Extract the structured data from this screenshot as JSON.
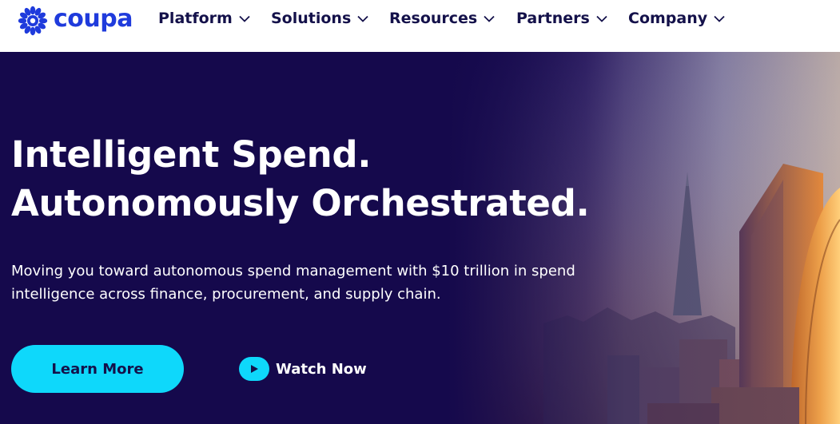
{
  "brand": {
    "name": "coupa",
    "color": "#1f3bdc",
    "icon": "coupa-starburst-icon"
  },
  "nav": {
    "items": [
      {
        "label": "Platform",
        "icon": "chevron-down-icon"
      },
      {
        "label": "Solutions",
        "icon": "chevron-down-icon"
      },
      {
        "label": "Resources",
        "icon": "chevron-down-icon"
      },
      {
        "label": "Partners",
        "icon": "chevron-down-icon"
      },
      {
        "label": "Company",
        "icon": "chevron-down-icon"
      }
    ],
    "text_color": "#14114a"
  },
  "hero": {
    "headline_line1": "Intelligent Spend.",
    "headline_line2": "Autonomously Orchestrated.",
    "subtext": "Moving you toward autonomous spend management with $10 trillion in spend intelligence across finance, procurement, and supply chain.",
    "primary_button": "Learn More",
    "secondary_button": "Watch Now",
    "secondary_icon": "play-icon",
    "background_color": "#15094c",
    "accent_color": "#0ed8fb",
    "image": "city-skyline-image"
  }
}
